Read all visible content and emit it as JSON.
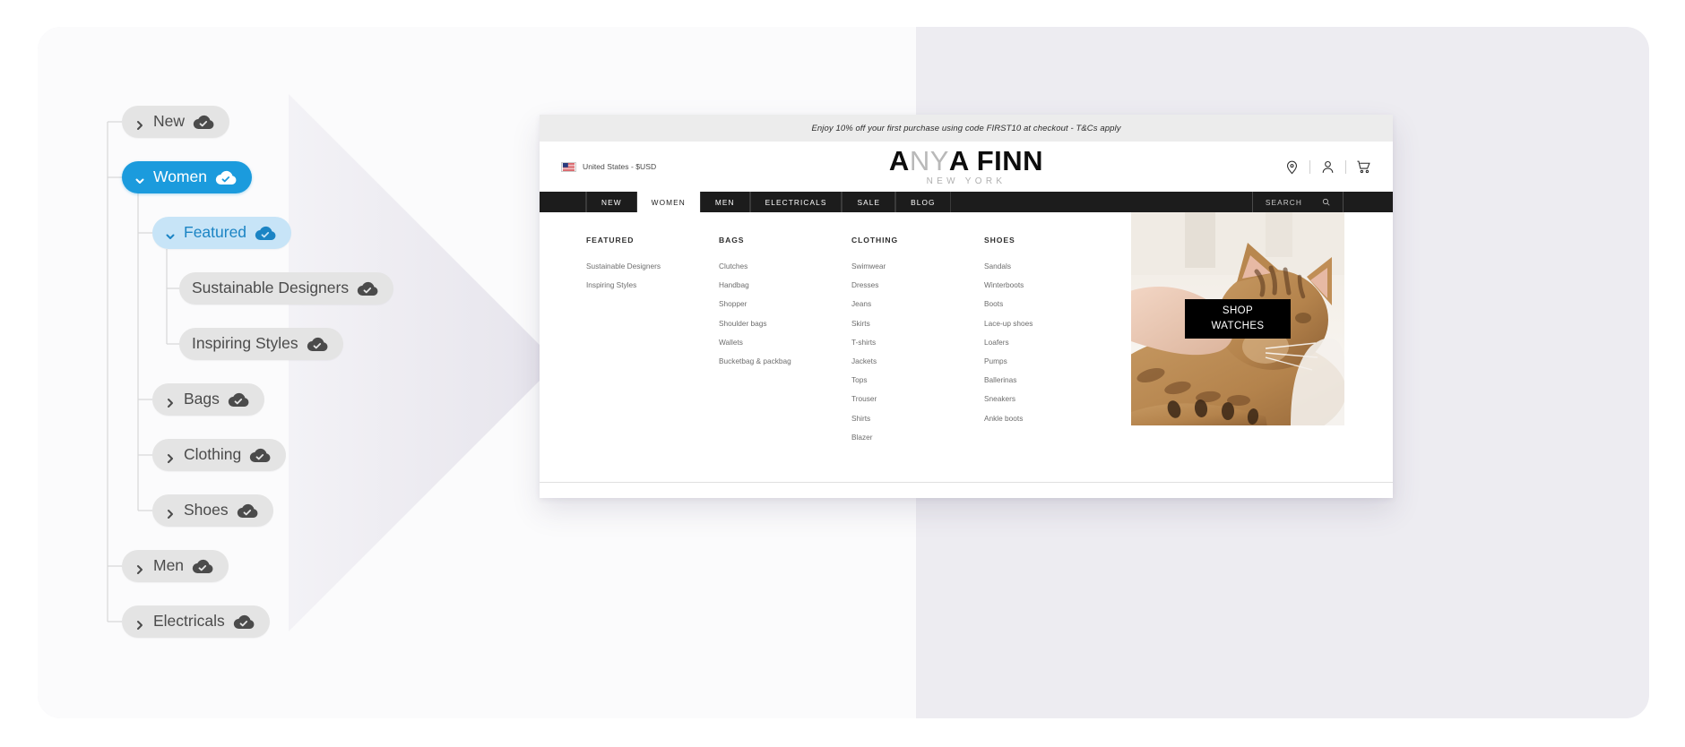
{
  "tree": {
    "nodes": [
      {
        "id": "new",
        "label": "New",
        "state": "collapsed",
        "icon": "cloud-check-icon",
        "chevron": "chevron-right-icon"
      },
      {
        "id": "women",
        "label": "Women",
        "state": "expanded",
        "icon": "cloud-check-icon",
        "chevron": "chevron-down-icon"
      },
      {
        "id": "featured",
        "label": "Featured",
        "state": "expanded",
        "icon": "cloud-check-icon",
        "chevron": "chevron-down-icon"
      },
      {
        "id": "sustain",
        "label": "Sustainable Designers",
        "state": "leaf",
        "icon": "cloud-check-icon",
        "chevron": ""
      },
      {
        "id": "inspiring",
        "label": "Inspiring Styles",
        "state": "leaf",
        "icon": "cloud-check-icon",
        "chevron": ""
      },
      {
        "id": "bags",
        "label": "Bags",
        "state": "collapsed",
        "icon": "cloud-check-icon",
        "chevron": "chevron-right-icon"
      },
      {
        "id": "clothing",
        "label": "Clothing",
        "state": "collapsed",
        "icon": "cloud-check-icon",
        "chevron": "chevron-right-icon"
      },
      {
        "id": "shoes",
        "label": "Shoes",
        "state": "collapsed",
        "icon": "cloud-check-icon",
        "chevron": "chevron-right-icon"
      },
      {
        "id": "men",
        "label": "Men",
        "state": "collapsed",
        "icon": "cloud-check-icon",
        "chevron": "chevron-right-icon"
      },
      {
        "id": "electrical",
        "label": "Electricals",
        "state": "collapsed",
        "icon": "cloud-check-icon",
        "chevron": "chevron-right-icon"
      }
    ],
    "colors": {
      "pill_default_bg": "#e4e4e4",
      "pill_default_text": "#4b4b4b",
      "pill_active_bg": "#1b9bdd",
      "pill_active_text": "#ffffff",
      "pill_subactive_bg": "#c7e4f7",
      "pill_subactive_text": "#1b84c4"
    }
  },
  "preview": {
    "promo_bar": {
      "text": "Enjoy 10% off your first purchase using code FIRST10 at checkout - T&Cs apply"
    },
    "header": {
      "locale": "United States - $USD",
      "flag_icon": "us-flag-icon",
      "logo": {
        "part1": "A",
        "part_light": "NY",
        "part2": "A FINN",
        "subtitle": "NEW YORK"
      },
      "icons": [
        {
          "name": "location-pin-icon",
          "label": "Store locator"
        },
        {
          "name": "user-account-icon",
          "label": "Account"
        },
        {
          "name": "shopping-cart-icon",
          "label": "Cart"
        }
      ]
    },
    "nav": {
      "items": [
        {
          "label": "NEW",
          "active": false
        },
        {
          "label": "WOMEN",
          "active": true
        },
        {
          "label": "MEN",
          "active": false
        },
        {
          "label": "ELECTRICALS",
          "active": false
        },
        {
          "label": "SALE",
          "active": false
        },
        {
          "label": "BLOG",
          "active": false
        }
      ],
      "search_placeholder": "SEARCH",
      "search_icon": "search-icon"
    },
    "mega_menu": {
      "columns": [
        {
          "heading": "FEATURED",
          "items": [
            "Sustainable Designers",
            "Inspiring Styles"
          ]
        },
        {
          "heading": "BAGS",
          "items": [
            "Clutches",
            "Handbag",
            "Shopper",
            "Shoulder bags",
            "Wallets",
            "Bucketbag & packbag"
          ]
        },
        {
          "heading": "CLOTHING",
          "items": [
            "Swimwear",
            "Dresses",
            "Jeans",
            "Skirts",
            "T-shirts",
            "Jackets",
            "Tops",
            "Trouser",
            "Shirts",
            "Blazer"
          ]
        },
        {
          "heading": "SHOES",
          "items": [
            "Sandals",
            "Winterboots",
            "Boots",
            "Lace-up shoes",
            "Loafers",
            "Pumps",
            "Ballerinas",
            "Sneakers",
            "Ankle boots"
          ]
        }
      ],
      "promo": {
        "image_alt": "hand petting a bengal cat on a white blanket",
        "cta_line1": "SHOP",
        "cta_line2": "WATCHES"
      }
    }
  }
}
